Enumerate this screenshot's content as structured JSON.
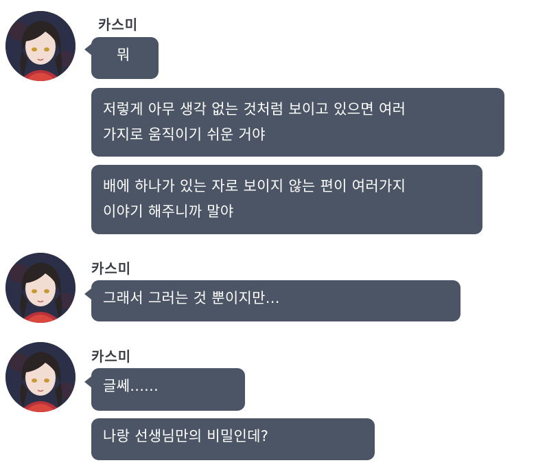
{
  "theme": {
    "bubble_color": "#4b5566",
    "bubble_text_color": "#ffffff",
    "name_color": "#3a3d45",
    "background": "#ffffff"
  },
  "groups": [
    {
      "sender": "카스미",
      "avatar_icon": "kasumi-avatar-icon",
      "messages": [
        "뭐",
        "저렇게 아무 생각 없는 것처럼 보이고 있으면 여러\n가지로 움직이기 쉬운 거야",
        "배에 하나가 있는 자로 보이지 않는 편이 여러가지\n이야기 해주니까 말야"
      ]
    },
    {
      "sender": "카스미",
      "avatar_icon": "kasumi-avatar-icon",
      "messages": [
        "그래서 그러는 것 뿐이지만..."
      ]
    },
    {
      "sender": "카스미",
      "avatar_icon": "kasumi-avatar-icon",
      "messages": [
        "글쎄......",
        "나랑 선생님만의 비밀인데?"
      ]
    }
  ]
}
